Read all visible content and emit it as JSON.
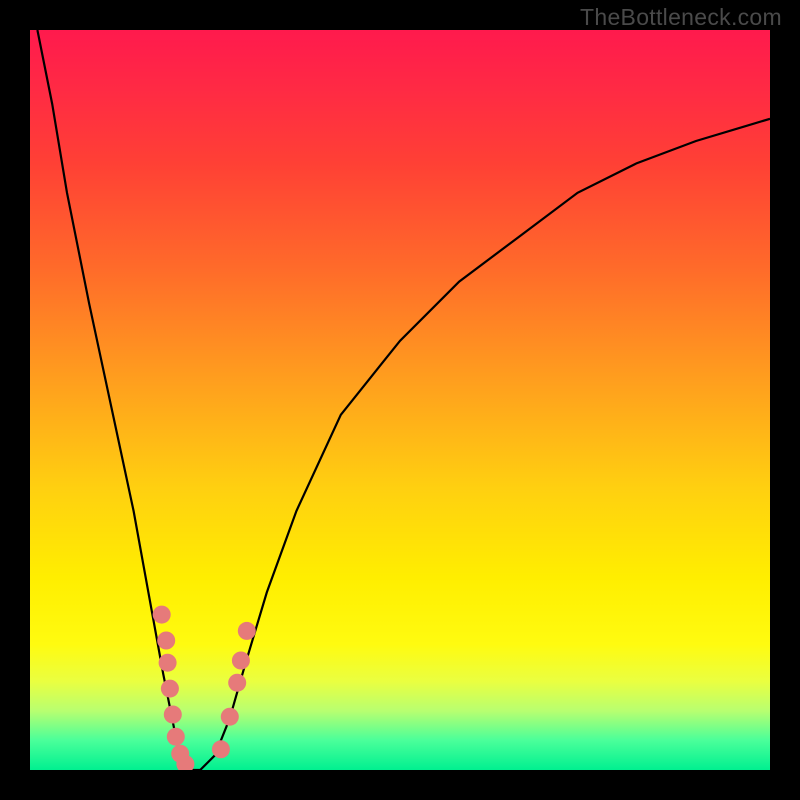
{
  "watermark": "TheBottleneck.com",
  "chart_data": {
    "type": "line",
    "title": "",
    "xlabel": "",
    "ylabel": "",
    "xlim": [
      0,
      100
    ],
    "ylim": [
      0,
      100
    ],
    "grid": false,
    "legend": false,
    "series": [
      {
        "name": "bottleneck-curve",
        "x": [
          1,
          3,
          5,
          8,
          11,
          14,
          16,
          18,
          19,
          20,
          21,
          22,
          23,
          24,
          25,
          27,
          29,
          32,
          36,
          42,
          50,
          58,
          66,
          74,
          82,
          90,
          100
        ],
        "y": [
          100,
          90,
          78,
          63,
          49,
          35,
          24,
          13,
          8,
          3,
          0,
          0,
          0,
          1,
          2,
          7,
          14,
          24,
          35,
          48,
          58,
          66,
          72,
          78,
          82,
          85,
          88
        ]
      }
    ],
    "markers": [
      {
        "group": "left",
        "points": [
          {
            "x": 17.8,
            "y": 21.0
          },
          {
            "x": 18.4,
            "y": 17.5
          },
          {
            "x": 18.6,
            "y": 14.5
          },
          {
            "x": 18.9,
            "y": 11.0
          },
          {
            "x": 19.3,
            "y": 7.5
          },
          {
            "x": 19.7,
            "y": 4.5
          },
          {
            "x": 20.3,
            "y": 2.2
          },
          {
            "x": 21.0,
            "y": 0.8
          }
        ]
      },
      {
        "group": "right",
        "points": [
          {
            "x": 25.8,
            "y": 2.8
          },
          {
            "x": 27.0,
            "y": 7.2
          },
          {
            "x": 28.0,
            "y": 11.8
          },
          {
            "x": 28.5,
            "y": 14.8
          },
          {
            "x": 29.3,
            "y": 18.8
          }
        ]
      }
    ],
    "gradient_stops": [
      {
        "pos": 0,
        "color": "#ff1a4d"
      },
      {
        "pos": 8,
        "color": "#ff2a44"
      },
      {
        "pos": 18,
        "color": "#ff4035"
      },
      {
        "pos": 32,
        "color": "#ff6a2a"
      },
      {
        "pos": 46,
        "color": "#ff9a1f"
      },
      {
        "pos": 62,
        "color": "#ffd010"
      },
      {
        "pos": 74,
        "color": "#ffee00"
      },
      {
        "pos": 83,
        "color": "#fffb10"
      },
      {
        "pos": 88,
        "color": "#eaff40"
      },
      {
        "pos": 92,
        "color": "#b8ff70"
      },
      {
        "pos": 96,
        "color": "#4aff9a"
      },
      {
        "pos": 100,
        "color": "#00f090"
      }
    ]
  }
}
